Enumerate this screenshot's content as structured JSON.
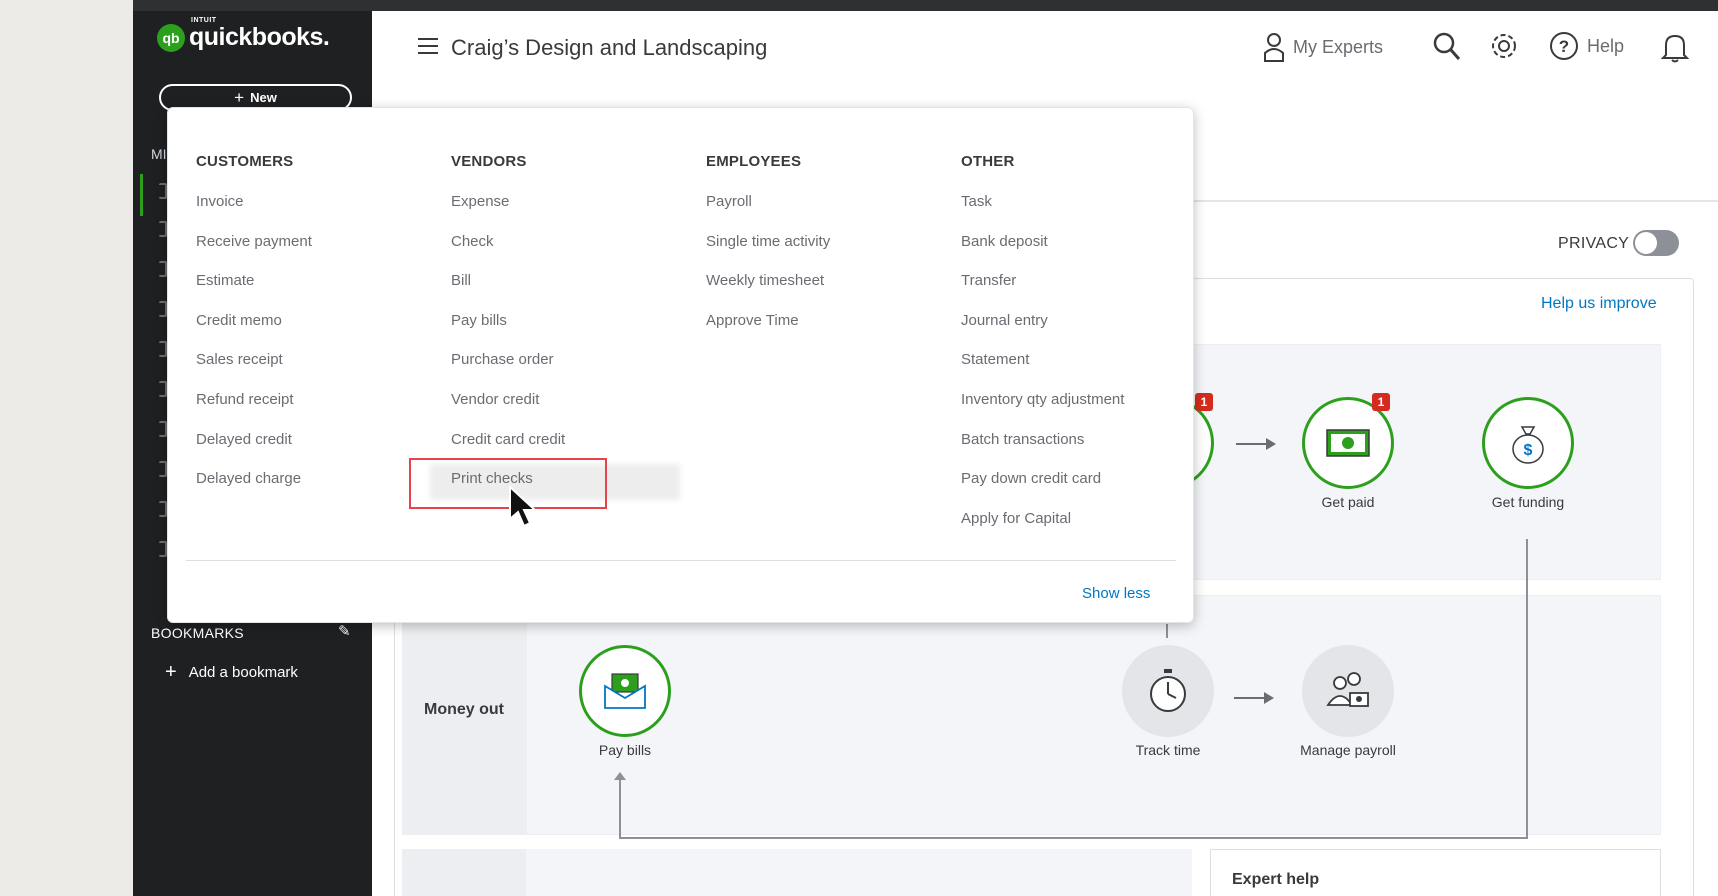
{
  "app": {
    "brand_small": "INTUIT",
    "brand": "quickbooks.",
    "logo_badge": "qb"
  },
  "sidebar": {
    "new_label": "New",
    "menu_fragment": "MI",
    "bookmarks_label": "BOOKMARKS",
    "add_bookmark": "Add a bookmark"
  },
  "header": {
    "company": "Craig’s Design and Landscaping",
    "my_experts": "My Experts",
    "help": "Help"
  },
  "dashboard": {
    "privacy": "PRIVACY",
    "help_improve": "Help us improve",
    "get_paid": "Get paid",
    "get_funding": "Get funding",
    "get_paid_badge": "1",
    "prev_badge": "1",
    "money_out": "Money out",
    "pay_bills": "Pay bills",
    "track_time": "Track time",
    "manage_payroll": "Manage payroll",
    "expert_help": "Expert help"
  },
  "new_menu": {
    "columns": [
      {
        "heading": "CUSTOMERS",
        "items": [
          "Invoice",
          "Receive payment",
          "Estimate",
          "Credit memo",
          "Sales receipt",
          "Refund receipt",
          "Delayed credit",
          "Delayed charge"
        ]
      },
      {
        "heading": "VENDORS",
        "items": [
          "Expense",
          "Check",
          "Bill",
          "Pay bills",
          "Purchase order",
          "Vendor credit",
          "Credit card credit",
          "Print checks"
        ]
      },
      {
        "heading": "EMPLOYEES",
        "items": [
          "Payroll",
          "Single time activity",
          "Weekly timesheet",
          "Approve Time"
        ]
      },
      {
        "heading": "OTHER",
        "items": [
          "Task",
          "Bank deposit",
          "Transfer",
          "Journal entry",
          "Statement",
          "Inventory qty adjustment",
          "Batch transactions",
          "Pay down credit card",
          "Apply for Capital"
        ]
      }
    ],
    "show_less": "Show less",
    "highlighted_item": "Print checks"
  },
  "colors": {
    "brand_green": "#2ca01c",
    "link_blue": "#0077c5",
    "sidebar_bg": "#1f2021",
    "alert_red": "#d52b1e",
    "highlight_red": "#e8434b"
  },
  "icons": [
    "menu-icon",
    "expert-icon",
    "search-icon",
    "gear-icon",
    "help-icon",
    "bell-icon",
    "money-icon",
    "money-bag-icon",
    "envelope-cash-icon",
    "stopwatch-icon",
    "payroll-people-icon",
    "pencil-icon",
    "plus-icon",
    "cursor-icon"
  ]
}
